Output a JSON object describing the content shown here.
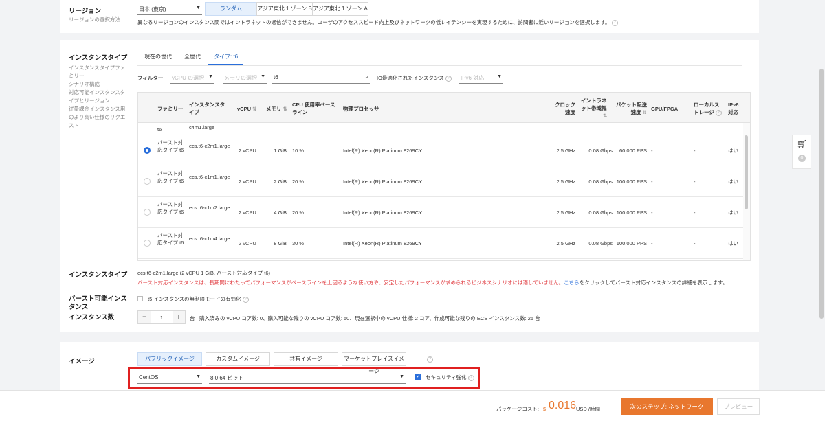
{
  "region": {
    "label": "リージョン",
    "sublabel": "リージョンの選択方法",
    "select_value": "日本 (東京)",
    "zones": [
      "ランダム",
      "アジア東北 1 ゾーン B",
      "アジア東北 1 ゾーン A"
    ],
    "note": "異なるリージョンのインスタンス間ではイントラネットの通信ができません。ユーザのアクセススピード向上及びネットワークの低レイテンシーを実現するために、訪問者に近いリージョンを選択します。"
  },
  "instance_type": {
    "label": "インスタンスタイプ",
    "side_links": [
      "インスタンスタイプファミリー",
      "シナリオ構成",
      "対応可能インスタンスタイプとリージョン",
      "従量課金インスタンス用のより高い仕様のリクエスト"
    ],
    "tabs": [
      "現在の世代",
      "全世代",
      "タイプ: t6"
    ],
    "filter_label": "フィルター",
    "vcpu_placeholder": "vCPU の選択",
    "memory_placeholder": "メモリの選択",
    "search_value": "t6",
    "io_label": "IO最適化されたインスタンス",
    "ipv6_placeholder": "IPv6 対応",
    "columns": [
      "ファミリー",
      "インスタンスタイプ",
      "vCPU",
      "メモリ",
      "CPU 使用率ベースライン",
      "物理プロセッサ",
      "クロック速度",
      "イントラネット帯域幅",
      "パケット転送速度",
      "GPU/FPGA",
      "ローカルストレージ",
      "IPv6 対応"
    ],
    "partial_row": {
      "family": "t6",
      "type": "c4m1.large"
    },
    "rows": [
      {
        "family": "バースト対応タイプ t6",
        "type": "ecs.t6-c2m1.large",
        "vcpu": "2 vCPU",
        "memory": "1 GiB",
        "baseline": "10 %",
        "processor": "Intel(R) Xeon(R) Platinum 8269CY",
        "clock": "2.5 GHz",
        "bandwidth": "0.08 Gbps",
        "pps": "60,000 PPS",
        "gpu": "-",
        "storage": "-",
        "ipv6": "はい",
        "selected": true
      },
      {
        "family": "バースト対応タイプ t6",
        "type": "ecs.t6-c1m1.large",
        "vcpu": "2 vCPU",
        "memory": "2 GiB",
        "baseline": "20 %",
        "processor": "Intel(R) Xeon(R) Platinum 8269CY",
        "clock": "2.5 GHz",
        "bandwidth": "0.08 Gbps",
        "pps": "100,000 PPS",
        "gpu": "-",
        "storage": "-",
        "ipv6": "はい",
        "selected": false
      },
      {
        "family": "バースト対応タイプ t6",
        "type": "ecs.t6-c1m2.large",
        "vcpu": "2 vCPU",
        "memory": "4 GiB",
        "baseline": "20 %",
        "processor": "Intel(R) Xeon(R) Platinum 8269CY",
        "clock": "2.5 GHz",
        "bandwidth": "0.08 Gbps",
        "pps": "100,000 PPS",
        "gpu": "-",
        "storage": "-",
        "ipv6": "はい",
        "selected": false
      },
      {
        "family": "バースト対応タイプ t6",
        "type": "ecs.t6-c1m4.large",
        "vcpu": "2 vCPU",
        "memory": "8 GiB",
        "baseline": "30 %",
        "processor": "Intel(R) Xeon(R) Platinum 8269CY",
        "clock": "2.5 GHz",
        "bandwidth": "0.08 Gbps",
        "pps": "100,000 PPS",
        "gpu": "-",
        "storage": "-",
        "ipv6": "はい",
        "selected": false
      }
    ],
    "summary_label": "インスタンスタイプ",
    "summary_value": "ecs.t6-c2m1.large (2 vCPU 1 GiB, バースト対応タイプ t6)",
    "warning_text": "バースト対応インスタンスは、長期間にわたってパフォーマンスがベースラインを上回るような使い方や、安定したパフォーマンスが求められるビジネスシナリオには適していません。",
    "warning_link": "こちら",
    "warning_tail": "をクリックしてバースト対応インスタンスの詳細を表示します。"
  },
  "burst": {
    "label": "バースト可能インスタンス",
    "checkbox_label": "t5 インスタンスの無制限モードの有効化"
  },
  "count": {
    "label": "インスタンス数",
    "value": "1",
    "unit": "台",
    "note": "購入済みの vCPU コア数: 0、購入可能な残りの vCPU コア数: 50、現在選択中の vCPU 仕様: 2 コア、作成可能な残りの ECS インスタンス数: 25 台"
  },
  "image": {
    "label": "イメージ",
    "tabs": [
      "パブリックイメージ",
      "カスタムイメージ",
      "共有イメージ",
      "マーケットプレイスイメージ"
    ],
    "os_value": "CentOS",
    "version_value": "8.0 64 ビット",
    "security_label": "セキュリティ強化"
  },
  "footer": {
    "cost_label": "パッケージコスト:",
    "currency": "$",
    "price": "0.016",
    "unit": "USD /時間",
    "next_button": "次のステップ: ネットワーク",
    "preview_button": "プレビュー"
  },
  "cart_count": "0",
  "colors": {
    "accent": "#2a6fdb",
    "primary_button": "#e8772e",
    "warning": "#e0393e",
    "highlight_border": "#e02020"
  }
}
